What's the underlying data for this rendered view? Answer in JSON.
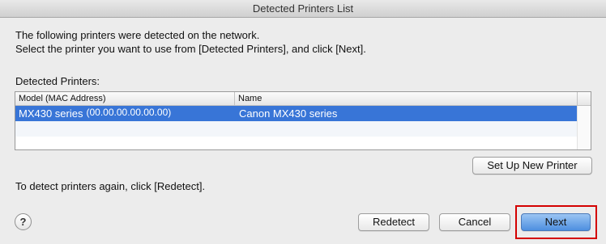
{
  "window": {
    "title": "Detected Printers List"
  },
  "intro": {
    "line1": "The following printers were detected on the network.",
    "line2": "Select the printer you want to use from [Detected Printers], and click [Next]."
  },
  "detected_label": "Detected Printers:",
  "table": {
    "columns": [
      "Model (MAC Address)",
      "Name"
    ],
    "rows": [
      {
        "model": "MX430 series",
        "mac": "(00.00.00.00.00.00)",
        "name": "Canon MX430 series",
        "selected": true
      }
    ]
  },
  "buttons": {
    "setup": "Set Up New Printer",
    "redetect": "Redetect",
    "cancel": "Cancel",
    "next": "Next",
    "help": "?"
  },
  "redetect_hint": "To detect printers again, click [Redetect].",
  "colors": {
    "selection": "#3875d7",
    "default_button": "#4d8fe0",
    "highlight_box": "#d40000"
  },
  "icons": {
    "help": "question-mark-icon"
  }
}
